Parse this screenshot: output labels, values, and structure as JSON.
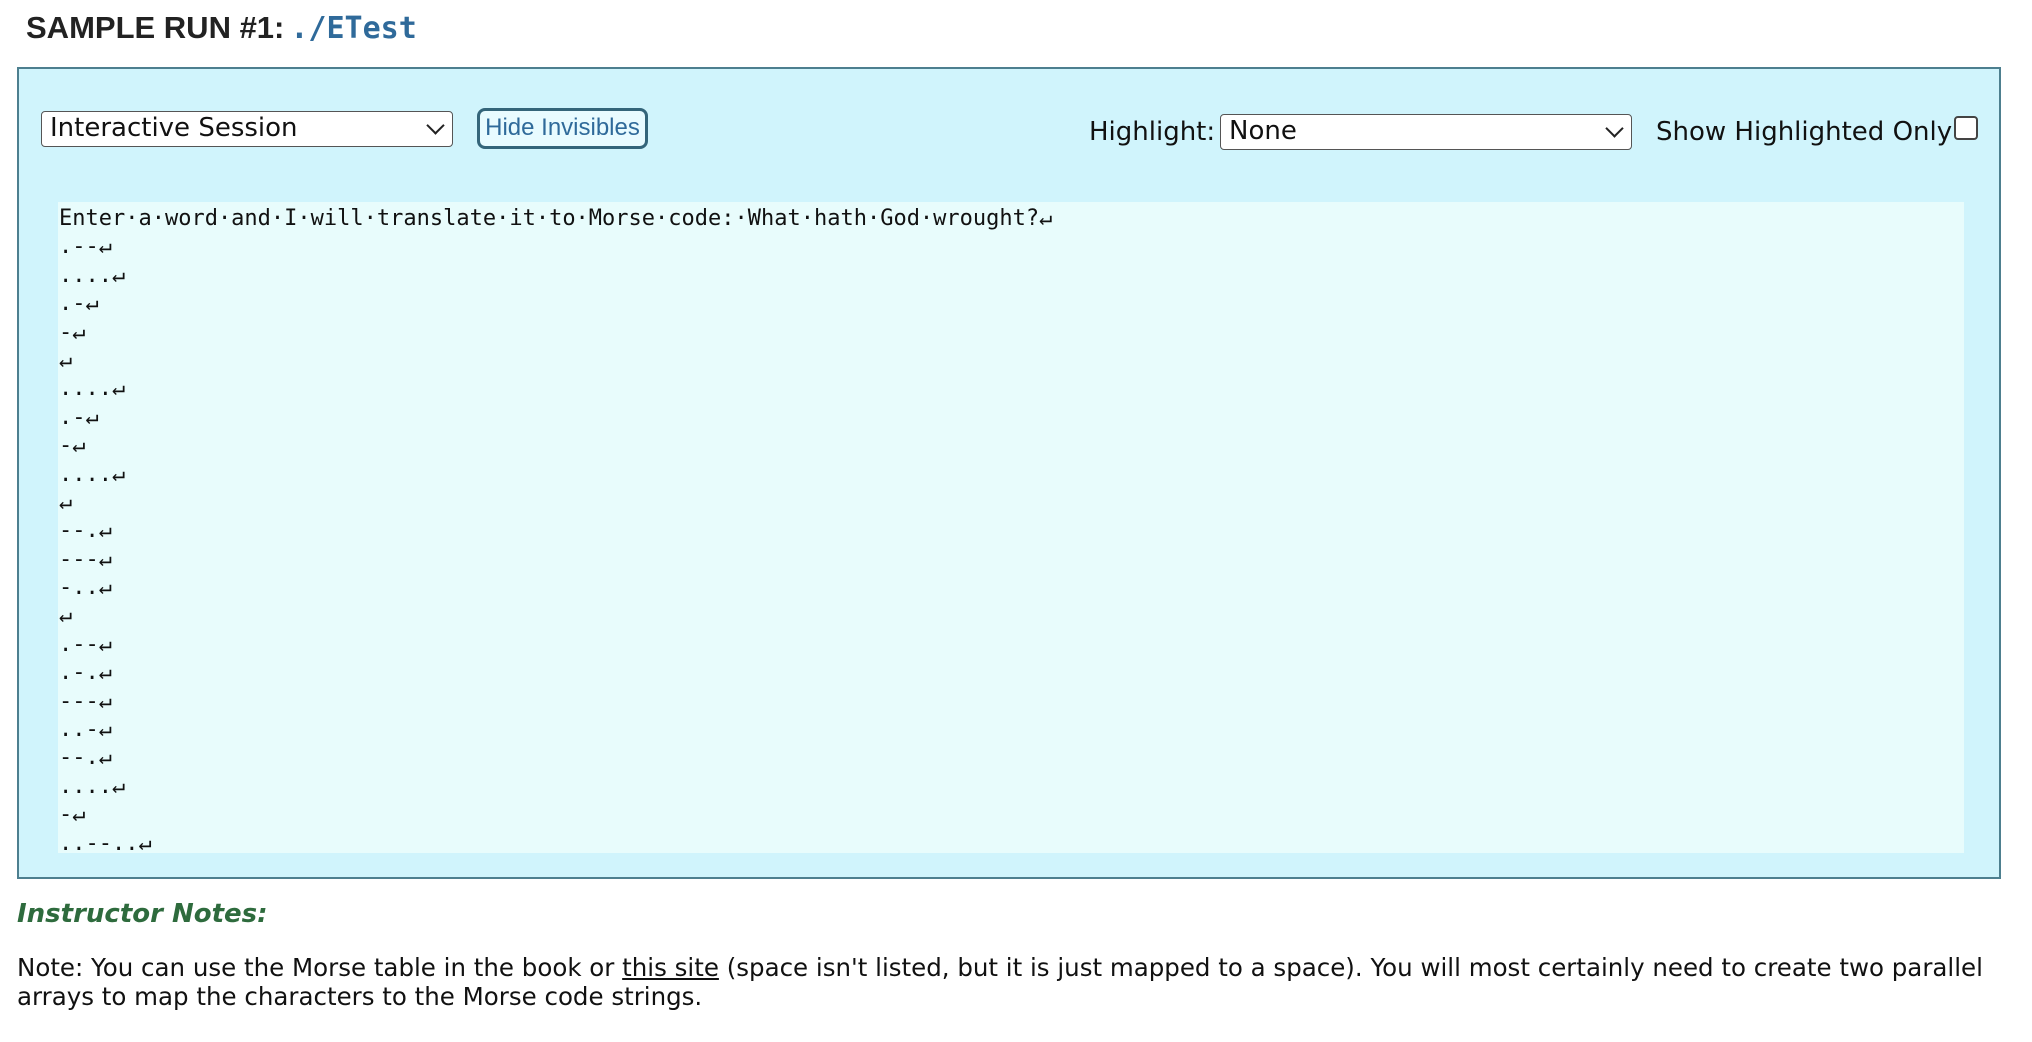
{
  "header": {
    "title": "SAMPLE RUN #1:",
    "command": "./ETest"
  },
  "controls": {
    "mode_selected": "Interactive Session",
    "hide_invisibles_label": "Hide Invisibles",
    "highlight_label": "Highlight:",
    "highlight_selected": "None",
    "show_highlighted_only_label": "Show Highlighted Only",
    "show_highlighted_only_checked": false
  },
  "output": {
    "lines": [
      "Enter·a·word·and·I·will·translate·it·to·Morse·code:·What·hath·God·wrought?↵",
      ".--↵",
      "....↵",
      ".-↵",
      "-↵",
      "↵",
      "....↵",
      ".-↵",
      "-↵",
      "....↵",
      "↵",
      "--.↵",
      "---↵",
      "-..↵",
      "↵",
      ".--↵",
      ".-.↵",
      "---↵",
      "..-↵",
      "--.↵",
      "....↵",
      "-↵",
      "..--..↵"
    ]
  },
  "notes": {
    "heading": "Instructor Notes:",
    "text_before_link": "Note: You can use the Morse table in the book or ",
    "link_text": "this site",
    "text_after_link": " (space isn't listed, but it is just mapped to a space). You will most certainly need to create two parallel arrays to map the characters to the Morse code strings."
  }
}
